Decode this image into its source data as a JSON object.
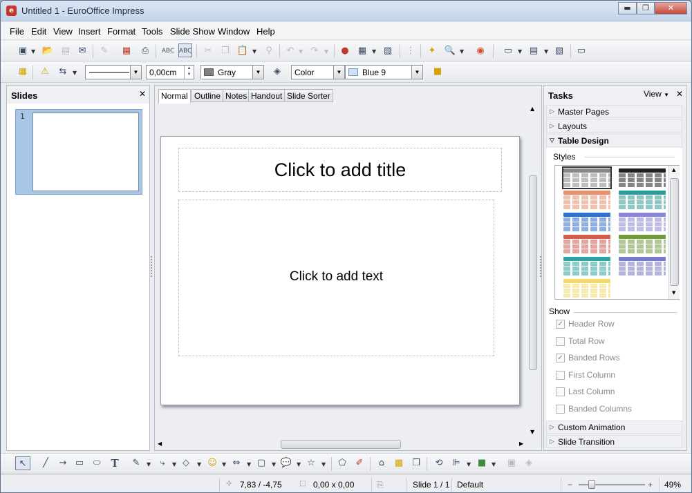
{
  "window": {
    "title": "Untitled 1 - EuroOffice Impress",
    "minimize": "▬",
    "restore": "❐",
    "close": "✕"
  },
  "menu": [
    "File",
    "Edit",
    "View",
    "Insert",
    "Format",
    "Tools",
    "Slide Show",
    "Window",
    "Help"
  ],
  "format_bar": {
    "line_width": "0,00cm",
    "area_color": "Gray",
    "area_color_hex": "#808080",
    "fill_mode": "Color",
    "fill_color": "Blue 9",
    "fill_color_hex": "#cfe3f6"
  },
  "slides_panel": {
    "title": "Slides",
    "close": "✕",
    "thumb_number": "1"
  },
  "view_tabs": [
    "Normal",
    "Outline",
    "Notes",
    "Handout",
    "Slide Sorter"
  ],
  "slide": {
    "title_placeholder": "Click to add title",
    "text_placeholder": "Click to add text"
  },
  "tasks": {
    "title": "Tasks",
    "view_label": "View",
    "close": "✕",
    "sections": [
      "Master Pages",
      "Layouts",
      "Table Design"
    ],
    "styles_label": "Styles",
    "show_label": "Show",
    "options": [
      {
        "label": "Header Row",
        "checked": true
      },
      {
        "label": "Total Row",
        "checked": false
      },
      {
        "label": "Banded Rows",
        "checked": true
      },
      {
        "label": "First Column",
        "checked": false
      },
      {
        "label": "Last Column",
        "checked": false
      },
      {
        "label": "Banded Columns",
        "checked": false
      }
    ],
    "bottom_sections": [
      "Custom Animation",
      "Slide Transition"
    ]
  },
  "table_styles": [
    [
      "#888888",
      "#222222"
    ],
    [
      "#e8916a",
      "#2e9c98"
    ],
    [
      "#2f6fd1",
      "#8a86d8"
    ],
    [
      "#d45a4a",
      "#6d9a3c"
    ],
    [
      "#2ba4a0",
      "#7777cc"
    ],
    [
      "#f3d86a",
      "#ffffff"
    ]
  ],
  "status": {
    "position": "7,83 / -4,75",
    "size": "0,00 x 0,00",
    "slide": "Slide 1 / 1",
    "master": "Default",
    "zoom": "49%"
  }
}
